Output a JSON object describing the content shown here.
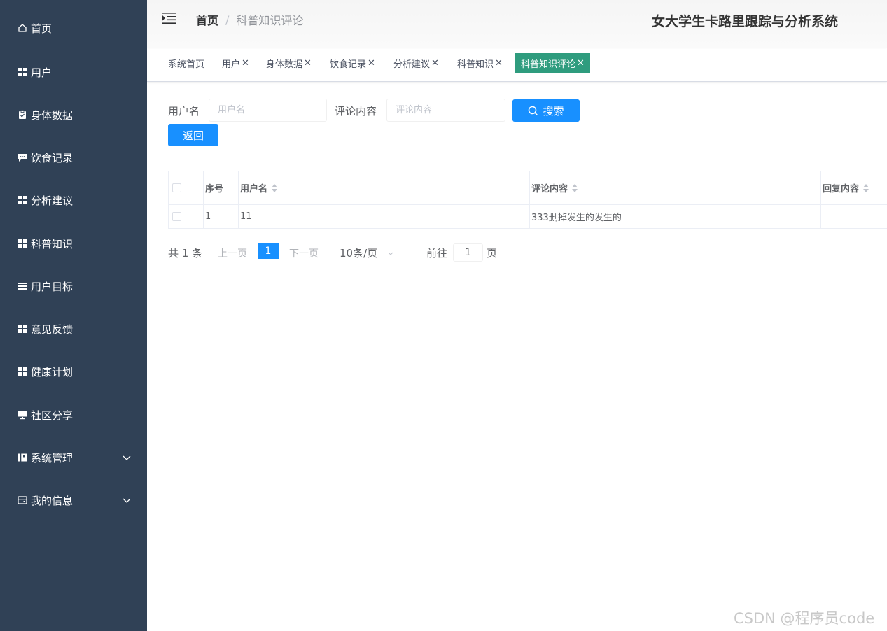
{
  "sidebar": {
    "items": [
      {
        "label": "首页",
        "icon": "home-icon"
      },
      {
        "label": "用户",
        "icon": "grid-icon"
      },
      {
        "label": "身体数据",
        "icon": "clipboard-icon"
      },
      {
        "label": "饮食记录",
        "icon": "chat-icon"
      },
      {
        "label": "分析建议",
        "icon": "grid-icon"
      },
      {
        "label": "科普知识",
        "icon": "grid-icon"
      },
      {
        "label": "用户目标",
        "icon": "list-icon"
      },
      {
        "label": "意见反馈",
        "icon": "grid-icon"
      },
      {
        "label": "健康计划",
        "icon": "grid-icon"
      },
      {
        "label": "社区分享",
        "icon": "monitor-icon"
      },
      {
        "label": "系统管理",
        "icon": "book-icon",
        "expandable": true
      },
      {
        "label": "我的信息",
        "icon": "wallet-icon",
        "expandable": true
      }
    ]
  },
  "header": {
    "breadcrumb_home": "首页",
    "breadcrumb_sep": "/",
    "breadcrumb_current": "科普知识评论",
    "system_title": "女大学生卡路里跟踪与分析系统"
  },
  "tags": [
    {
      "label": "系统首页",
      "closable": false,
      "active": false
    },
    {
      "label": "用户",
      "closable": true,
      "active": false
    },
    {
      "label": "身体数据",
      "closable": true,
      "active": false
    },
    {
      "label": "饮食记录",
      "closable": true,
      "active": false
    },
    {
      "label": "分析建议",
      "closable": true,
      "active": false
    },
    {
      "label": "科普知识",
      "closable": true,
      "active": false
    },
    {
      "label": "科普知识评论",
      "closable": true,
      "active": true
    }
  ],
  "search": {
    "username_label": "用户名",
    "username_placeholder": "用户名",
    "content_label": "评论内容",
    "content_placeholder": "评论内容",
    "search_button": "搜索",
    "back_button": "返回"
  },
  "table": {
    "columns": [
      "序号",
      "用户名",
      "评论内容",
      "回复内容"
    ],
    "rows": [
      {
        "index": "1",
        "username": "11",
        "content": "333删掉发生的发生的",
        "reply": ""
      }
    ]
  },
  "pagination": {
    "total": "共 1 条",
    "prev": "上一页",
    "current_page": "1",
    "next": "下一页",
    "page_size": "10条/页",
    "goto_label": "前往",
    "goto_value": "1",
    "goto_suffix": "页"
  },
  "watermark": "CSDN @程序员code",
  "colors": {
    "sidebar_bg": "#304156",
    "primary": "#1890ff",
    "active_tag": "#2f9c7e"
  }
}
